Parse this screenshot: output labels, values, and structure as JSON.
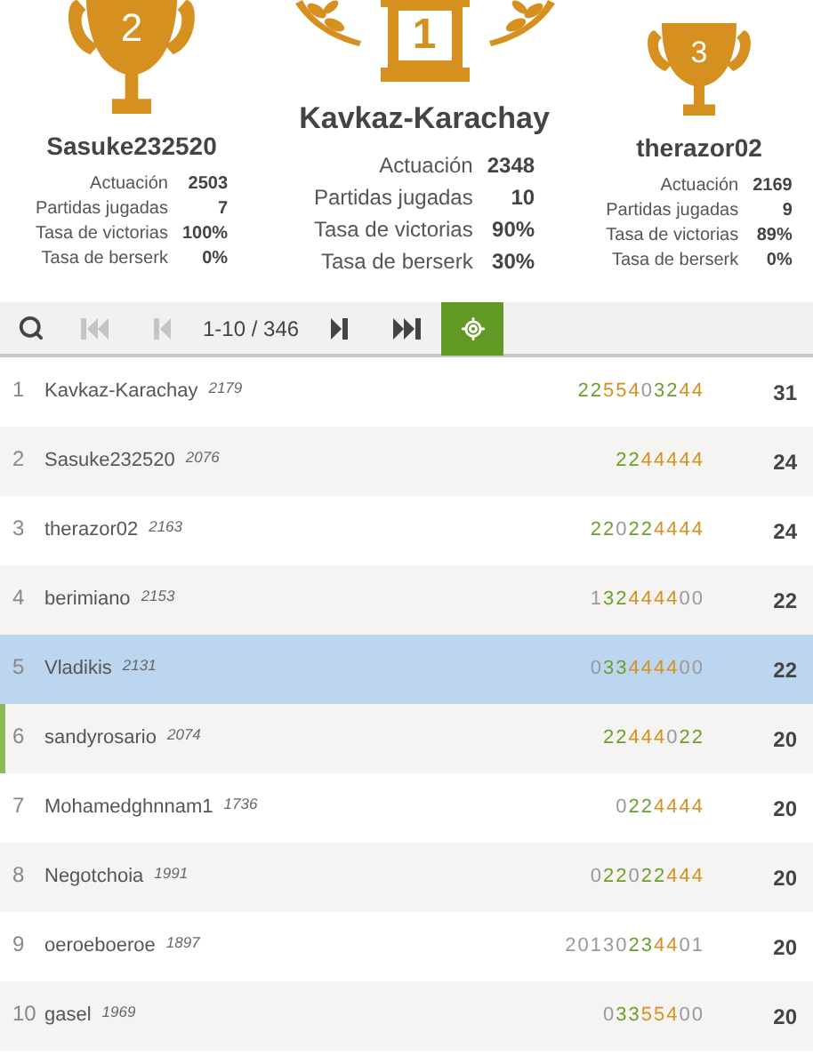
{
  "podium": [
    {
      "place": "2",
      "kind": "second",
      "name": "Sasuke232520",
      "stats": [
        {
          "label": "Actuación",
          "value": "2503"
        },
        {
          "label": "Partidas jugadas",
          "value": "7"
        },
        {
          "label": "Tasa de victorias",
          "value": "100%"
        },
        {
          "label": "Tasa de berserk",
          "value": "0%"
        }
      ]
    },
    {
      "place": "1",
      "kind": "first",
      "name": "Kavkaz-Karachay",
      "stats": [
        {
          "label": "Actuación",
          "value": "2348"
        },
        {
          "label": "Partidas jugadas",
          "value": "10"
        },
        {
          "label": "Tasa de victorias",
          "value": "90%"
        },
        {
          "label": "Tasa de berserk",
          "value": "30%"
        }
      ]
    },
    {
      "place": "3",
      "kind": "third",
      "name": "therazor02",
      "stats": [
        {
          "label": "Actuación",
          "value": "2169"
        },
        {
          "label": "Partidas jugadas",
          "value": "9"
        },
        {
          "label": "Tasa de victorias",
          "value": "89%"
        },
        {
          "label": "Tasa de berserk",
          "value": "0%"
        }
      ]
    }
  ],
  "pager": {
    "first_disabled": true,
    "prev_disabled": true,
    "range": "1-10 / 346",
    "next_disabled": false,
    "last_disabled": false,
    "locate_on": true
  },
  "rows": [
    {
      "rank": "1",
      "name": "Kavkaz-Karachay",
      "rating": "2179",
      "selected": false,
      "marked": false,
      "points": "31",
      "scores": [
        {
          "text": "2",
          "color": "#6a9f2a"
        },
        {
          "text": "2",
          "color": "#6a9f2a"
        },
        {
          "text": "5",
          "color": "#d5901f"
        },
        {
          "text": "5",
          "color": "#d5901f"
        },
        {
          "text": "4",
          "color": "#d5901f"
        },
        {
          "text": "0",
          "color": "#9a9a9a"
        },
        {
          "text": "3",
          "color": "#6a9f2a"
        },
        {
          "text": "2",
          "color": "#6a9f2a"
        },
        {
          "text": "4",
          "color": "#d5901f"
        },
        {
          "text": "4",
          "color": "#d5901f"
        }
      ]
    },
    {
      "rank": "2",
      "name": "Sasuke232520",
      "rating": "2076",
      "selected": false,
      "marked": false,
      "points": "24",
      "scores": [
        {
          "text": "2",
          "color": "#6a9f2a"
        },
        {
          "text": "2",
          "color": "#6a9f2a"
        },
        {
          "text": "4",
          "color": "#d5901f"
        },
        {
          "text": "4",
          "color": "#d5901f"
        },
        {
          "text": "4",
          "color": "#d5901f"
        },
        {
          "text": "4",
          "color": "#d5901f"
        },
        {
          "text": "4",
          "color": "#d5901f"
        }
      ]
    },
    {
      "rank": "3",
      "name": "therazor02",
      "rating": "2163",
      "selected": false,
      "marked": false,
      "points": "24",
      "scores": [
        {
          "text": "2",
          "color": "#6a9f2a"
        },
        {
          "text": "2",
          "color": "#6a9f2a"
        },
        {
          "text": "0",
          "color": "#9a9a9a"
        },
        {
          "text": "2",
          "color": "#6a9f2a"
        },
        {
          "text": "2",
          "color": "#6a9f2a"
        },
        {
          "text": "4",
          "color": "#d5901f"
        },
        {
          "text": "4",
          "color": "#d5901f"
        },
        {
          "text": "4",
          "color": "#d5901f"
        },
        {
          "text": "4",
          "color": "#d5901f"
        }
      ]
    },
    {
      "rank": "4",
      "name": "berimiano",
      "rating": "2153",
      "selected": false,
      "marked": false,
      "points": "22",
      "scores": [
        {
          "text": "1",
          "color": "#9a9a9a"
        },
        {
          "text": "3",
          "color": "#6a9f2a"
        },
        {
          "text": "2",
          "color": "#6a9f2a"
        },
        {
          "text": "4",
          "color": "#d5901f"
        },
        {
          "text": "4",
          "color": "#d5901f"
        },
        {
          "text": "4",
          "color": "#d5901f"
        },
        {
          "text": "4",
          "color": "#d5901f"
        },
        {
          "text": "0",
          "color": "#9a9a9a"
        },
        {
          "text": "0",
          "color": "#9a9a9a"
        }
      ]
    },
    {
      "rank": "5",
      "name": "Vladikis",
      "rating": "2131",
      "selected": true,
      "marked": false,
      "points": "22",
      "scores": [
        {
          "text": "0",
          "color": "#9a9a9a"
        },
        {
          "text": "3",
          "color": "#6a9f2a"
        },
        {
          "text": "3",
          "color": "#6a9f2a"
        },
        {
          "text": "4",
          "color": "#d5901f"
        },
        {
          "text": "4",
          "color": "#d5901f"
        },
        {
          "text": "4",
          "color": "#d5901f"
        },
        {
          "text": "4",
          "color": "#d5901f"
        },
        {
          "text": "0",
          "color": "#9a9a9a"
        },
        {
          "text": "0",
          "color": "#9a9a9a"
        }
      ]
    },
    {
      "rank": "6",
      "name": "sandyrosario",
      "rating": "2074",
      "selected": false,
      "marked": true,
      "points": "20",
      "scores": [
        {
          "text": "2",
          "color": "#6a9f2a"
        },
        {
          "text": "2",
          "color": "#6a9f2a"
        },
        {
          "text": "4",
          "color": "#d5901f"
        },
        {
          "text": "4",
          "color": "#d5901f"
        },
        {
          "text": "4",
          "color": "#d5901f"
        },
        {
          "text": "0",
          "color": "#9a9a9a"
        },
        {
          "text": "2",
          "color": "#6a9f2a"
        },
        {
          "text": "2",
          "color": "#6a9f2a"
        }
      ]
    },
    {
      "rank": "7",
      "name": "Mohamedghnnam1",
      "rating": "1736",
      "selected": false,
      "marked": false,
      "points": "20",
      "scores": [
        {
          "text": "0",
          "color": "#9a9a9a"
        },
        {
          "text": "2",
          "color": "#6a9f2a"
        },
        {
          "text": "2",
          "color": "#6a9f2a"
        },
        {
          "text": "4",
          "color": "#d5901f"
        },
        {
          "text": "4",
          "color": "#d5901f"
        },
        {
          "text": "4",
          "color": "#d5901f"
        },
        {
          "text": "4",
          "color": "#d5901f"
        }
      ]
    },
    {
      "rank": "8",
      "name": "Negotchoia",
      "rating": "1991",
      "selected": false,
      "marked": false,
      "points": "20",
      "scores": [
        {
          "text": "0",
          "color": "#9a9a9a"
        },
        {
          "text": "2",
          "color": "#6a9f2a"
        },
        {
          "text": "2",
          "color": "#6a9f2a"
        },
        {
          "text": "0",
          "color": "#9a9a9a"
        },
        {
          "text": "2",
          "color": "#6a9f2a"
        },
        {
          "text": "2",
          "color": "#6a9f2a"
        },
        {
          "text": "4",
          "color": "#d5901f"
        },
        {
          "text": "4",
          "color": "#d5901f"
        },
        {
          "text": "4",
          "color": "#d5901f"
        }
      ]
    },
    {
      "rank": "9",
      "name": "oeroeboeroe",
      "rating": "1897",
      "selected": false,
      "marked": false,
      "points": "20",
      "scores": [
        {
          "text": "2",
          "color": "#9a9a9a"
        },
        {
          "text": "0",
          "color": "#9a9a9a"
        },
        {
          "text": "1",
          "color": "#9a9a9a"
        },
        {
          "text": "3",
          "color": "#9a9a9a"
        },
        {
          "text": "0",
          "color": "#9a9a9a"
        },
        {
          "text": "2",
          "color": "#6a9f2a"
        },
        {
          "text": "3",
          "color": "#6a9f2a"
        },
        {
          "text": "4",
          "color": "#d5901f"
        },
        {
          "text": "4",
          "color": "#d5901f"
        },
        {
          "text": "0",
          "color": "#9a9a9a"
        },
        {
          "text": "1",
          "color": "#9a9a9a"
        }
      ]
    },
    {
      "rank": "10",
      "name": "gasel",
      "rating": "1969",
      "selected": false,
      "marked": false,
      "points": "20",
      "scores": [
        {
          "text": "0",
          "color": "#9a9a9a"
        },
        {
          "text": "3",
          "color": "#6a9f2a"
        },
        {
          "text": "3",
          "color": "#6a9f2a"
        },
        {
          "text": "5",
          "color": "#d5901f"
        },
        {
          "text": "5",
          "color": "#d5901f"
        },
        {
          "text": "4",
          "color": "#d5901f"
        },
        {
          "text": "0",
          "color": "#9a9a9a"
        },
        {
          "text": "0",
          "color": "#9a9a9a"
        }
      ]
    }
  ]
}
